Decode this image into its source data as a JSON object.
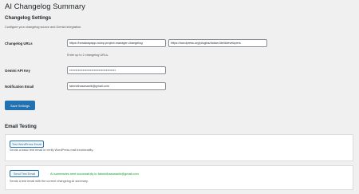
{
  "page": {
    "title": "AI Changelog Summary"
  },
  "settings": {
    "heading": "Changelog Settings",
    "description": "Configure your changelog source and Gemini integration.",
    "changelog_urls_label": "Changelog URLs",
    "url_1": "https://headwayapp.co/wp-project-manager-changelog",
    "url_2": "https://wordpress.org/plugins/dokan-lite/#developers",
    "urls_hint": "Enter up to 2 changelog URLs.",
    "api_key_label": "Gemini API Key",
    "api_key_value": "••••••••••••••••••••••••••••••••••••••",
    "email_label": "Notification Email",
    "email_value": "fahmidhasananik@gmail.com",
    "save_label": "Save Settings"
  },
  "email_testing": {
    "heading": "Email Testing",
    "test_email_button": "Test WordPress Email",
    "test_email_desc": "Sends a basic test email to verify WordPress mail functionality.",
    "send_test_button": "Send Test Email",
    "success_message": "AI summaries sent successfully to fahmidhasananik@gmail.com",
    "send_test_desc": "Sends a test email with the current changelog AI summary."
  },
  "colors": {
    "primary": "#2271b1",
    "success": "#00a32a",
    "background": "#f0f0f1"
  }
}
